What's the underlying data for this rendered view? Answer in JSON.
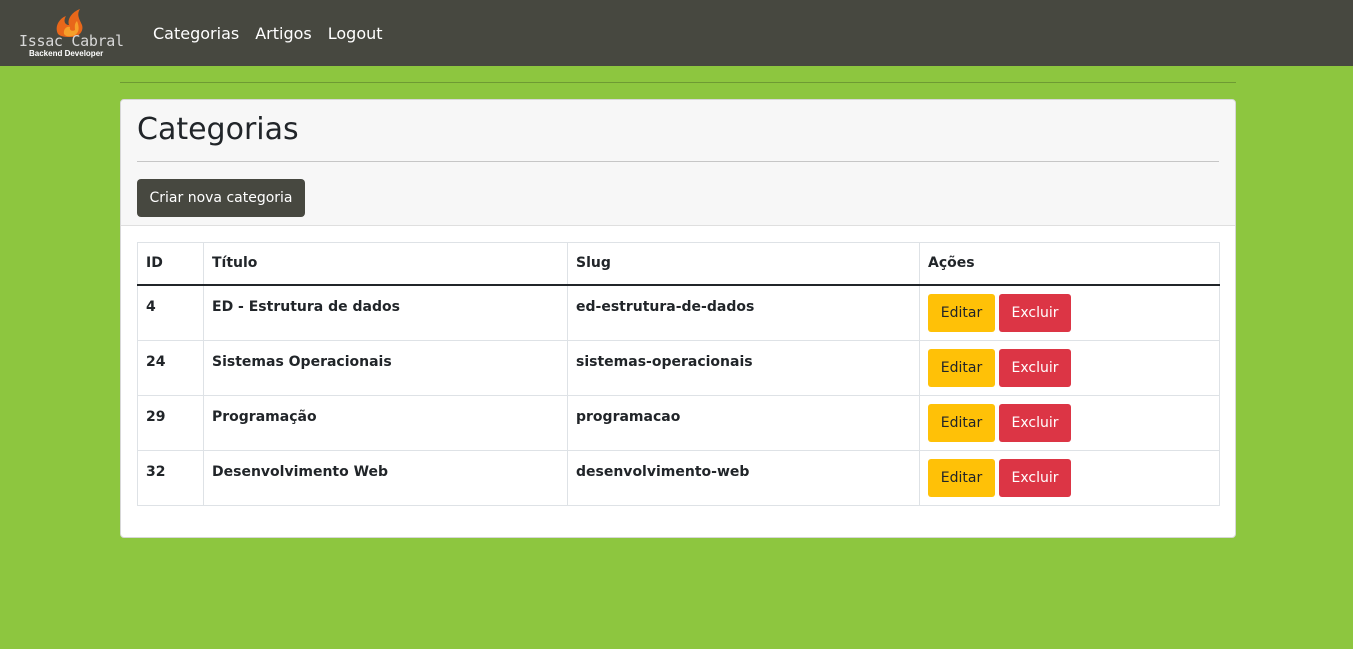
{
  "brand": {
    "name": "Issac Cabral",
    "subtitle": "Backend Developer",
    "colors": {
      "flame_outer": "#e8671a",
      "flame_inner": "#f7a02a"
    }
  },
  "nav": {
    "items": [
      {
        "label": "Categorias"
      },
      {
        "label": "Artigos"
      },
      {
        "label": "Logout"
      }
    ]
  },
  "page": {
    "title": "Categorias",
    "create_button": "Criar nova categoria"
  },
  "table": {
    "headers": [
      "ID",
      "Título",
      "Slug",
      "Ações"
    ],
    "rows": [
      {
        "id": "4",
        "title": "ED - Estrutura de dados",
        "slug": "ed-estrutura-de-dados"
      },
      {
        "id": "24",
        "title": "Sistemas Operacionais",
        "slug": "sistemas-operacionais"
      },
      {
        "id": "29",
        "title": "Programação",
        "slug": "programacao"
      },
      {
        "id": "32",
        "title": "Desenvolvimento Web",
        "slug": "desenvolvimento-web"
      }
    ],
    "edit_label": "Editar",
    "delete_label": "Excluir"
  },
  "colors": {
    "background": "#8dc63f",
    "navbar": "#474840",
    "edit_button": "#ffc107",
    "delete_button": "#dc3545",
    "create_button": "#474840"
  }
}
